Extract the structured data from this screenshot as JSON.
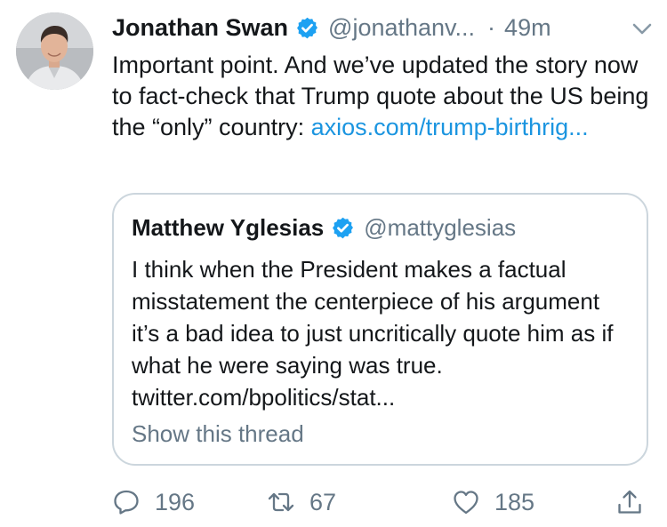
{
  "tweet": {
    "author_name": "Jonathan Swan",
    "handle": "@jonathanv...",
    "separator": "·",
    "time": "49m",
    "text_plain": "Important point. And we’ve updated the story now to fact-check that Trump quote about the US being the “only” country: ",
    "text_link": "axios.com/trump-birthrig..."
  },
  "quote": {
    "author_name": "Matthew Yglesias",
    "handle": "@mattyglesias",
    "text": "I think when the President makes a factual misstatement the centerpiece of his argument it’s a bad idea to just uncritically quote him as if what he were saying was true. twitter.com/bpolitics/stat...",
    "show_thread": "Show this thread"
  },
  "actions": {
    "reply_count": "196",
    "retweet_count": "67",
    "like_count": "185",
    "reply_icon": "reply-icon",
    "retweet_icon": "retweet-icon",
    "like_icon": "heart-icon",
    "share_icon": "share-icon"
  },
  "colors": {
    "link": "#1b95e0",
    "verified": "#1da1f2",
    "secondary_text": "#657786",
    "border": "#ccd6dd"
  }
}
